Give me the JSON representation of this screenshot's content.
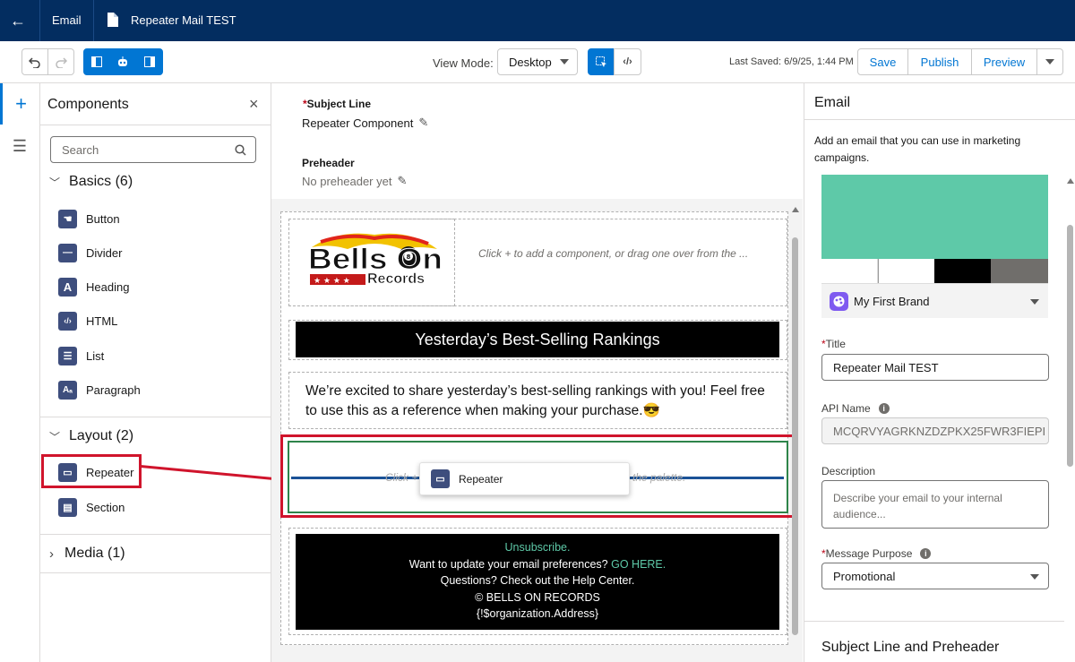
{
  "topbar": {
    "app": "Email",
    "title": "Repeater Mail TEST"
  },
  "toolbar": {
    "view_mode_label": "View Mode:",
    "view_mode_value": "Desktop",
    "last_saved": "Last Saved: 6/9/25, 1:44 PM",
    "save": "Save",
    "publish": "Publish",
    "preview": "Preview"
  },
  "components": {
    "title": "Components",
    "search_placeholder": "Search",
    "basics_label": "Basics (6)",
    "basics": [
      {
        "label": "Button",
        "icon": "button-icon"
      },
      {
        "label": "Divider",
        "icon": "divider-icon"
      },
      {
        "label": "Heading",
        "icon": "heading-icon"
      },
      {
        "label": "HTML",
        "icon": "html-icon"
      },
      {
        "label": "List",
        "icon": "list-icon"
      },
      {
        "label": "Paragraph",
        "icon": "paragraph-icon"
      }
    ],
    "layout_label": "Layout (2)",
    "layout": [
      {
        "label": "Repeater",
        "icon": "repeater-icon"
      },
      {
        "label": "Section",
        "icon": "section-icon"
      }
    ],
    "media_label": "Media (1)"
  },
  "canvas": {
    "subject_label": "Subject Line",
    "subject_value": "Repeater Component",
    "preheader_label": "Preheader",
    "preheader_value": "No preheader yet",
    "logo_line1": "Bells On",
    "logo_line2": "Records",
    "placeholder": "Click + to add a component, or drag one over from the ...",
    "banner": "Yesterday’s Best-Selling Rankings",
    "paragraph": "We’re excited to share yesterday’s best-selling rankings with you! Feel free to use this as a reference when making your purchase.",
    "paragraph_emoji": "😎",
    "drop_left": "Click +",
    "drop_right": "the palette.",
    "drag_label": "Repeater",
    "footer": {
      "unsubscribe": "Unsubscribe.",
      "prefs": "Want to update your email preferences?",
      "go_here": "GO HERE.",
      "help": "Questions? Check out the Help Center.",
      "copyright": "© BELLS ON RECORDS",
      "address": "{!$organization.Address}"
    }
  },
  "right": {
    "title": "Email",
    "desc": "Add an email that you can use in marketing campaigns.",
    "brand": "My First Brand",
    "brand_colors": [
      "#5ec9a8",
      "#ffffff",
      "#ffffff",
      "#000000",
      "#706e6b"
    ],
    "title_label": "Title",
    "title_value": "Repeater Mail TEST",
    "api_label": "API Name",
    "api_value": "MCQRVYAGRKNZDZPKX25FWR3FIEPI",
    "description_label": "Description",
    "description_placeholder": "Describe your email to your internal audience...",
    "purpose_label": "Message Purpose",
    "purpose_value": "Promotional",
    "subject_section": "Subject Line and Preheader"
  }
}
